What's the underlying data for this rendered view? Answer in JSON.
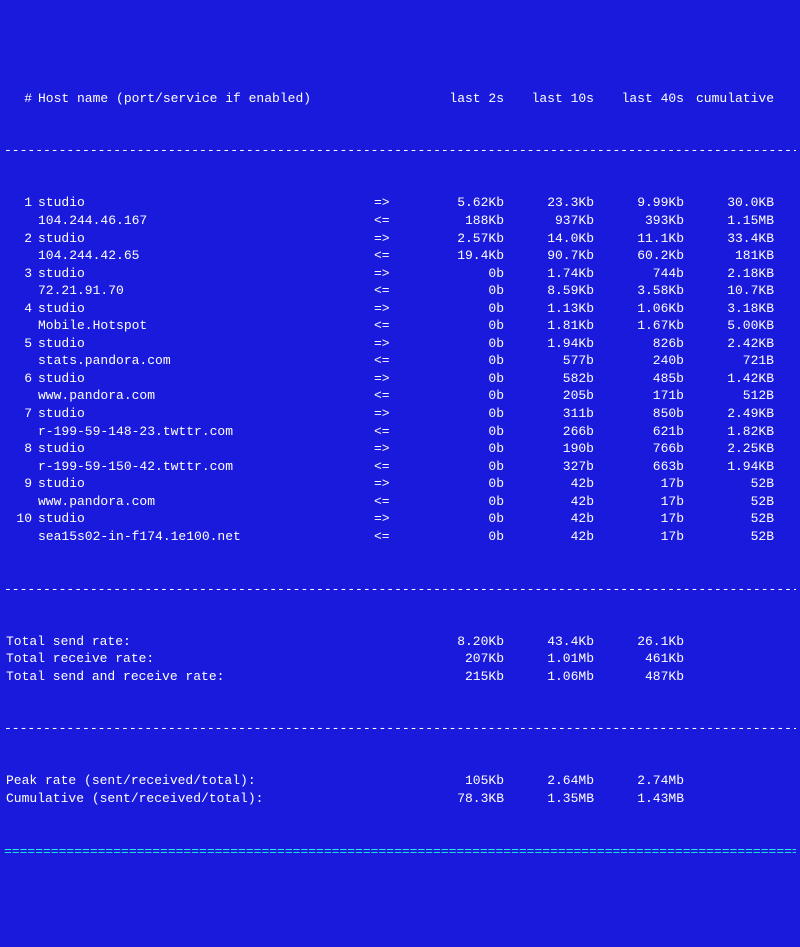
{
  "header": {
    "idx": "#",
    "host": "Host name (port/service if enabled)",
    "last2s": "last 2s",
    "last10s": "last 10s",
    "last40s": "last 40s",
    "cum": "cumulative"
  },
  "rows": [
    {
      "n": "1",
      "host": "studio",
      "dir": "=>",
      "l2": "5.62Kb",
      "l10": "23.3Kb",
      "l40": "9.99Kb",
      "cum": "30.0KB"
    },
    {
      "n": "",
      "host": "104.244.46.167",
      "dir": "<=",
      "l2": "188Kb",
      "l10": "937Kb",
      "l40": "393Kb",
      "cum": "1.15MB"
    },
    {
      "n": "2",
      "host": "studio",
      "dir": "=>",
      "l2": "2.57Kb",
      "l10": "14.0Kb",
      "l40": "11.1Kb",
      "cum": "33.4KB"
    },
    {
      "n": "",
      "host": "104.244.42.65",
      "dir": "<=",
      "l2": "19.4Kb",
      "l10": "90.7Kb",
      "l40": "60.2Kb",
      "cum": "181KB"
    },
    {
      "n": "3",
      "host": "studio",
      "dir": "=>",
      "l2": "0b",
      "l10": "1.74Kb",
      "l40": "744b",
      "cum": "2.18KB"
    },
    {
      "n": "",
      "host": "72.21.91.70",
      "dir": "<=",
      "l2": "0b",
      "l10": "8.59Kb",
      "l40": "3.58Kb",
      "cum": "10.7KB"
    },
    {
      "n": "4",
      "host": "studio",
      "dir": "=>",
      "l2": "0b",
      "l10": "1.13Kb",
      "l40": "1.06Kb",
      "cum": "3.18KB"
    },
    {
      "n": "",
      "host": "Mobile.Hotspot",
      "dir": "<=",
      "l2": "0b",
      "l10": "1.81Kb",
      "l40": "1.67Kb",
      "cum": "5.00KB"
    },
    {
      "n": "5",
      "host": "studio",
      "dir": "=>",
      "l2": "0b",
      "l10": "1.94Kb",
      "l40": "826b",
      "cum": "2.42KB"
    },
    {
      "n": "",
      "host": "stats.pandora.com",
      "dir": "<=",
      "l2": "0b",
      "l10": "577b",
      "l40": "240b",
      "cum": "721B"
    },
    {
      "n": "6",
      "host": "studio",
      "dir": "=>",
      "l2": "0b",
      "l10": "582b",
      "l40": "485b",
      "cum": "1.42KB"
    },
    {
      "n": "",
      "host": "www.pandora.com",
      "dir": "<=",
      "l2": "0b",
      "l10": "205b",
      "l40": "171b",
      "cum": "512B"
    },
    {
      "n": "7",
      "host": "studio",
      "dir": "=>",
      "l2": "0b",
      "l10": "311b",
      "l40": "850b",
      "cum": "2.49KB"
    },
    {
      "n": "",
      "host": "r-199-59-148-23.twttr.com",
      "dir": "<=",
      "l2": "0b",
      "l10": "266b",
      "l40": "621b",
      "cum": "1.82KB"
    },
    {
      "n": "8",
      "host": "studio",
      "dir": "=>",
      "l2": "0b",
      "l10": "190b",
      "l40": "766b",
      "cum": "2.25KB"
    },
    {
      "n": "",
      "host": "r-199-59-150-42.twttr.com",
      "dir": "<=",
      "l2": "0b",
      "l10": "327b",
      "l40": "663b",
      "cum": "1.94KB"
    },
    {
      "n": "9",
      "host": "studio",
      "dir": "=>",
      "l2": "0b",
      "l10": "42b",
      "l40": "17b",
      "cum": "52B"
    },
    {
      "n": "",
      "host": "www.pandora.com",
      "dir": "<=",
      "l2": "0b",
      "l10": "42b",
      "l40": "17b",
      "cum": "52B"
    },
    {
      "n": "10",
      "host": "studio",
      "dir": "=>",
      "l2": "0b",
      "l10": "42b",
      "l40": "17b",
      "cum": "52B"
    },
    {
      "n": "",
      "host": "sea15s02-in-f174.1e100.net",
      "dir": "<=",
      "l2": "0b",
      "l10": "42b",
      "l40": "17b",
      "cum": "52B"
    }
  ],
  "totals": [
    {
      "label": "Total send rate:",
      "l2": "8.20Kb",
      "l10": "43.4Kb",
      "l40": "26.1Kb",
      "cum": ""
    },
    {
      "label": "Total receive rate:",
      "l2": "207Kb",
      "l10": "1.01Mb",
      "l40": "461Kb",
      "cum": ""
    },
    {
      "label": "Total send and receive rate:",
      "l2": "215Kb",
      "l10": "1.06Mb",
      "l40": "487Kb",
      "cum": ""
    }
  ],
  "summary": [
    {
      "label": "Peak rate (sent/received/total):",
      "l2": "105Kb",
      "l10": "2.64Mb",
      "l40": "2.74Mb",
      "cum": ""
    },
    {
      "label": "Cumulative (sent/received/total):",
      "l2": "78.3KB",
      "l10": "1.35MB",
      "l40": "1.43MB",
      "cum": ""
    }
  ],
  "sep": {
    "dash": "--------------------------------------------------------------------------------------------------------",
    "dbl": "========================================================================================================"
  }
}
